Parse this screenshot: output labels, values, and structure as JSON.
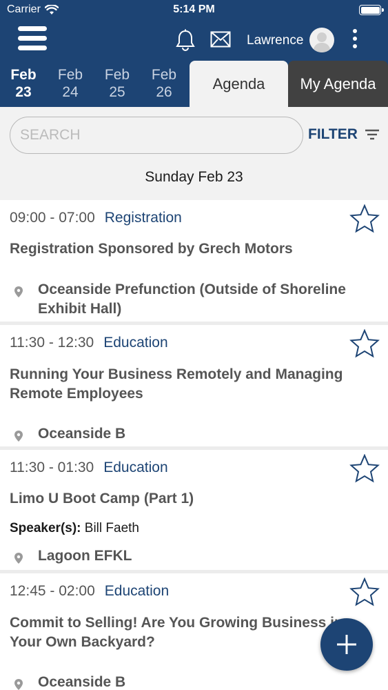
{
  "status_bar": {
    "carrier": "Carrier",
    "time": "5:14 PM"
  },
  "header": {
    "user_name": "Lawrence"
  },
  "date_tabs": [
    {
      "month": "Feb",
      "day": "23",
      "active": true
    },
    {
      "month": "Feb",
      "day": "24",
      "active": false
    },
    {
      "month": "Feb",
      "day": "25",
      "active": false
    },
    {
      "month": "Feb",
      "day": "26",
      "active": false
    }
  ],
  "view_tabs": {
    "agenda": "Agenda",
    "my_agenda": "My Agenda"
  },
  "search": {
    "placeholder": "SEARCH",
    "filter_label": "FILTER"
  },
  "day_heading": "Sunday Feb 23",
  "sessions": [
    {
      "time": "09:00 - 07:00",
      "category": "Registration",
      "title": "Registration Sponsored by Grech Motors",
      "speaker_label": "",
      "speaker": "",
      "location": "Oceanside Prefunction (Outside of Shoreline Exhibit Hall)"
    },
    {
      "time": "11:30 - 12:30",
      "category": "Education",
      "title": "Running Your Business Remotely and Managing Remote Employees",
      "speaker_label": "",
      "speaker": "",
      "location": "Oceanside B"
    },
    {
      "time": "11:30 - 01:30",
      "category": "Education",
      "title": "Limo U Boot Camp (Part 1)",
      "speaker_label": "Speaker(s):",
      "speaker": "Bill Faeth",
      "location": "Lagoon EFKL"
    },
    {
      "time": "12:45 - 02:00",
      "category": "Education",
      "title": "Commit to Selling! Are You Growing Business in Your Own Backyard?",
      "speaker_label": "",
      "speaker": "",
      "location": "Oceanside B"
    }
  ],
  "icons": {
    "menu": "hamburger-menu-icon",
    "notifications": "bell-icon",
    "messages": "envelope-icon",
    "avatar": "user-avatar-icon",
    "more": "kebab-menu-icon",
    "filter": "filter-lines-icon",
    "favorite": "star-outline-icon",
    "location": "map-pin-icon",
    "add": "plus-icon"
  },
  "colors": {
    "brand_navy": "#1d4474",
    "my_agenda_tab": "#414141",
    "background_gray": "#f2f2f2"
  }
}
